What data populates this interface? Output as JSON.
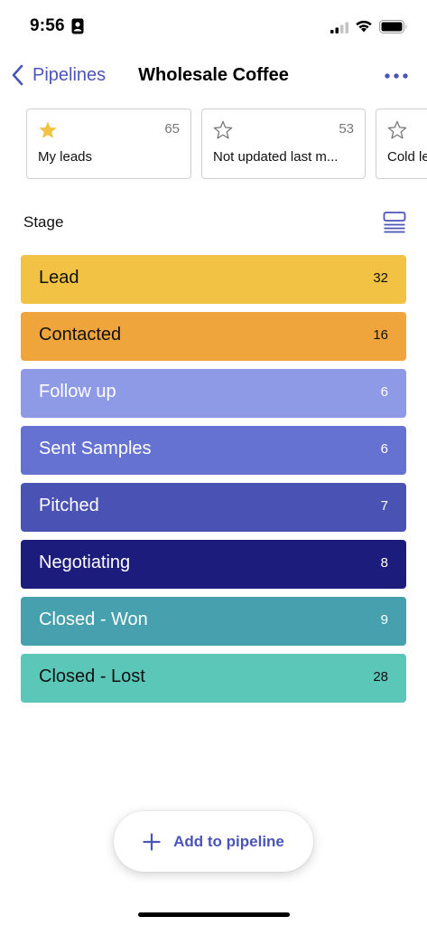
{
  "status_bar": {
    "time": "9:56"
  },
  "nav": {
    "back_label": "Pipelines",
    "title": "Wholesale Coffee"
  },
  "filters": [
    {
      "label": "My leads",
      "count": "65",
      "starred": true,
      "icon": "star-filled-icon"
    },
    {
      "label": "Not updated last m...",
      "count": "53",
      "starred": false,
      "icon": "star-outline-icon"
    },
    {
      "label": "Cold le",
      "count": "",
      "starred": false,
      "icon": "star-outline-icon"
    }
  ],
  "stage_section": {
    "title": "Stage",
    "view_icon": "list-view-icon"
  },
  "stages": [
    {
      "name": "Lead",
      "count": "32",
      "color": "#f2c244",
      "text_color": "#111111"
    },
    {
      "name": "Contacted",
      "count": "16",
      "color": "#f0a43c",
      "text_color": "#111111"
    },
    {
      "name": "Follow up",
      "count": "6",
      "color": "#8e9ae6",
      "text_color": "#ffffff"
    },
    {
      "name": "Sent Samples",
      "count": "6",
      "color": "#6672d1",
      "text_color": "#ffffff"
    },
    {
      "name": "Pitched",
      "count": "7",
      "color": "#4a52b4",
      "text_color": "#ffffff"
    },
    {
      "name": "Negotiating",
      "count": "8",
      "color": "#1c1c7c",
      "text_color": "#ffffff"
    },
    {
      "name": "Closed - Won",
      "count": "9",
      "color": "#46a0ae",
      "text_color": "#ffffff"
    },
    {
      "name": "Closed - Lost",
      "count": "28",
      "color": "#5ac7b8",
      "text_color": "#111111"
    }
  ],
  "add_button": {
    "label": "Add to pipeline",
    "icon": "plus-icon"
  },
  "colors": {
    "accent": "#4a55b8",
    "star": "#f2c244"
  }
}
